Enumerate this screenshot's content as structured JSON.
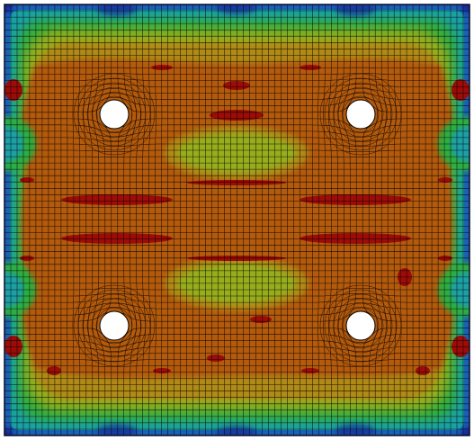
{
  "colors": {
    "background": "#ffffff",
    "border": "#0a0a1e",
    "band_blue": "#1a5fb8",
    "band_teal": "#1aa0a6",
    "band_green": "#2fae3c",
    "band_yellowgreen": "#97ad1d",
    "band_olive": "#b08a14",
    "field_orange": "#b35a10",
    "hotspot_red": "#9c0c08",
    "mesh_line": "#000000",
    "hole_fill": "#ffffff",
    "corner_deep_blue": "#142b98"
  },
  "icons": [
    "mesh-plot",
    "hole-marker"
  ],
  "plot": {
    "mesh_columns": 74,
    "mesh_rows": 68,
    "hole_count": 4
  }
}
